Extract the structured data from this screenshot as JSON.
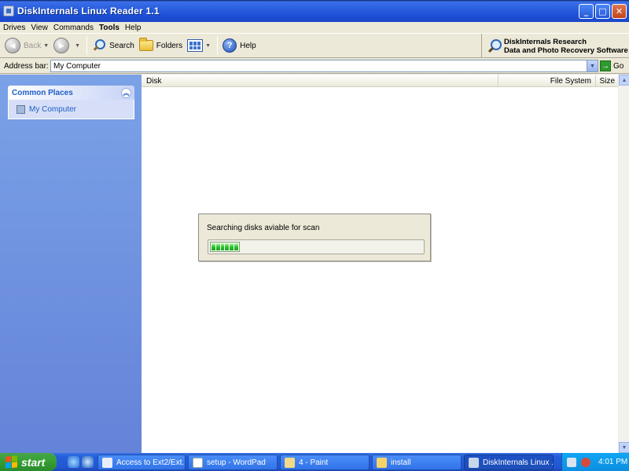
{
  "window": {
    "title": "DiskInternals Linux Reader 1.1",
    "min_glyph": "_",
    "max_glyph": "□",
    "close_glyph": "✕"
  },
  "menu": [
    "Drives",
    "View",
    "Commands",
    "Tools",
    "Help"
  ],
  "toolbar": {
    "back_label": "Back",
    "back_glyph": "◄",
    "forward_glyph": "►",
    "search_label": "Search",
    "folders_label": "Folders",
    "help_label": "Help",
    "help_glyph": "?",
    "dropdown_glyph": "▼",
    "brand_line1": "DiskInternals Research",
    "brand_line2": "Data and Photo Recovery Software"
  },
  "address": {
    "label": "Address bar:",
    "value": "My Computer",
    "go_label": "Go",
    "go_glyph": "→",
    "dropdown_glyph": "▼"
  },
  "sidebar": {
    "section_title": "Common Places",
    "collapse_glyph": "︽",
    "items": [
      {
        "label": "My Computer"
      }
    ]
  },
  "list": {
    "columns": [
      "Disk",
      "File System",
      "Size"
    ],
    "scroll_up_glyph": "▲",
    "scroll_down_glyph": "▼"
  },
  "dialog": {
    "message": "Searching disks aviable for scan",
    "progress": 0.14
  },
  "taskbar": {
    "start_label": "start",
    "tasks": [
      {
        "label": "Access to Ext2/Ext...",
        "active": false
      },
      {
        "label": "setup - WordPad",
        "active": false
      },
      {
        "label": "4 - Paint",
        "active": false
      },
      {
        "label": "install",
        "active": false
      },
      {
        "label": "DiskInternals Linux ...",
        "active": true
      }
    ],
    "clock": "4:01 PM"
  },
  "colors": {
    "xp_blue": "#245edb",
    "sidebar_blue": "#7ba2e7",
    "progress_green": "#2cc42c",
    "start_green": "#36a136"
  }
}
